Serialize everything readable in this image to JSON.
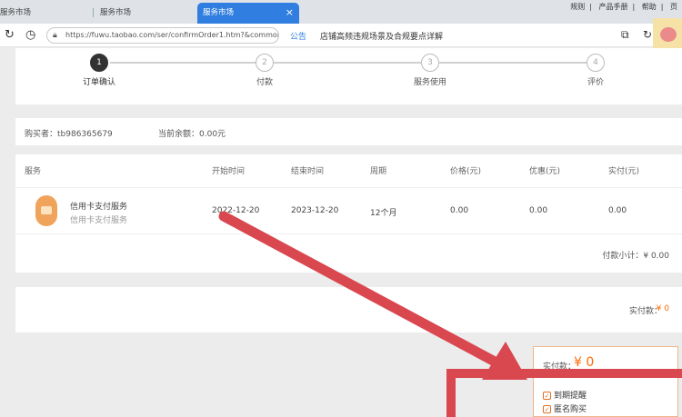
{
  "tabs": [
    {
      "label": "服务市场"
    },
    {
      "label": "服务市场"
    },
    {
      "label": "服务市场"
    }
  ],
  "tab_close": "×",
  "top_links": [
    "规则",
    "产品手册",
    "帮助",
    "页"
  ],
  "address": {
    "url": "https://fuwu.taobao.com/ser/confirmOrder1.htm?&commonPa",
    "notice_label": "公告",
    "notice_text": "店铺高频违规场景及合规要点详解"
  },
  "steps": [
    {
      "num": "1",
      "label": "订单确认"
    },
    {
      "num": "2",
      "label": "付款"
    },
    {
      "num": "3",
      "label": "服务使用"
    },
    {
      "num": "4",
      "label": "评价"
    }
  ],
  "buyer": {
    "buyer_text": "购买者：tb986365679",
    "balance_text": "当前余额：0.00元"
  },
  "table": {
    "headers": [
      "服务",
      "开始时间",
      "结束时间",
      "周期",
      "价格(元)",
      "优惠(元)",
      "实付(元)"
    ],
    "row": {
      "name": "信用卡支付服务",
      "sub": "信用卡支付服务",
      "start": "2022-12-20",
      "end": "2023-12-20",
      "period": "12个月",
      "price": "0.00",
      "discount": "0.00",
      "paid": "0.00"
    },
    "subtotal": "付款小计：¥ 0.00"
  },
  "pay": {
    "label": "实付款：",
    "value": "¥ 0"
  },
  "summary": {
    "label": "实付款：",
    "amount": "¥ 0",
    "options": [
      {
        "label": "到期提醒",
        "checked": true
      },
      {
        "label": "匿名购买",
        "checked": true
      }
    ]
  },
  "colors": {
    "accent": "#2f7ee0",
    "price": "#ff6a00",
    "annotation": "#d9474f"
  }
}
